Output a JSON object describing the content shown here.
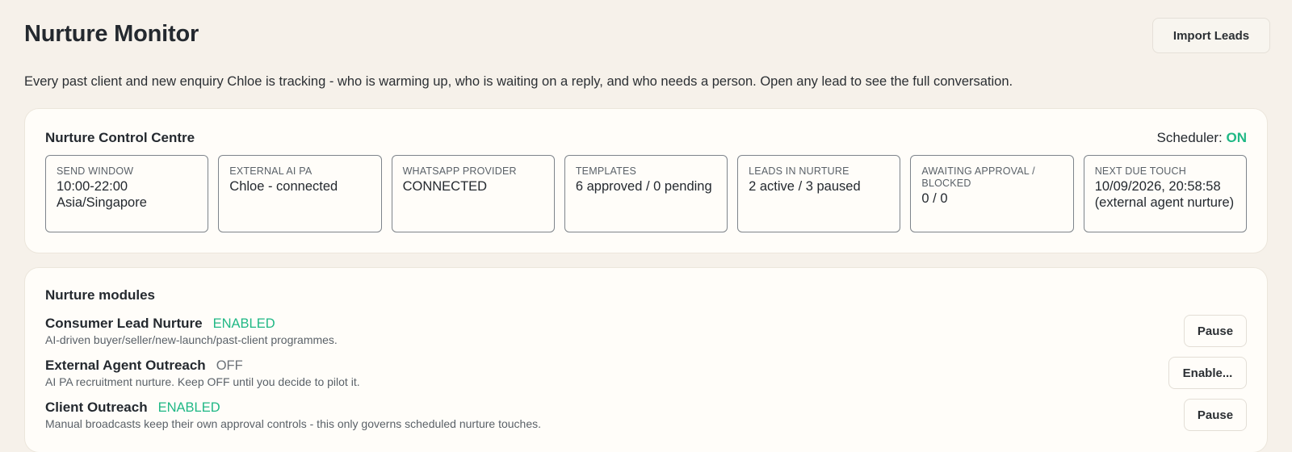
{
  "header": {
    "title": "Nurture Monitor",
    "import_label": "Import Leads"
  },
  "description": "Every past client and new enquiry Chloe is tracking - who is warming up, who is waiting on a reply, and who needs a person. Open any lead to see the full conversation.",
  "control_centre": {
    "title": "Nurture Control Centre",
    "scheduler_label": "Scheduler:",
    "scheduler_value": "ON",
    "stats": [
      {
        "label": "SEND WINDOW",
        "value": "10:00-22:00 Asia/Singapore"
      },
      {
        "label": "EXTERNAL AI PA",
        "value": "Chloe - connected"
      },
      {
        "label": "WHATSAPP PROVIDER",
        "value": "CONNECTED"
      },
      {
        "label": "TEMPLATES",
        "value": "6 approved / 0 pending"
      },
      {
        "label": "LEADS IN NURTURE",
        "value": "2 active / 3 paused"
      },
      {
        "label": "AWAITING APPROVAL / BLOCKED",
        "value": "0 / 0"
      },
      {
        "label": "NEXT DUE TOUCH",
        "value": "10/09/2026, 20:58:58 (external agent nurture)"
      }
    ]
  },
  "modules": {
    "title": "Nurture modules",
    "items": [
      {
        "name": "Consumer Lead Nurture",
        "status": "ENABLED",
        "description": "AI-driven buyer/seller/new-launch/past-client programmes.",
        "action": "Pause"
      },
      {
        "name": "External Agent Outreach",
        "status": "OFF",
        "description": "AI PA recruitment nurture. Keep OFF until you decide to pilot it.",
        "action": "Enable..."
      },
      {
        "name": "Client Outreach",
        "status": "ENABLED",
        "description": "Manual broadcasts keep their own approval controls - this only governs scheduled nurture touches.",
        "action": "Pause"
      }
    ]
  },
  "colors": {
    "background": "#f6f1ea",
    "card": "#fffdf9",
    "accent_green": "#1fb885",
    "text": "#24292f"
  }
}
